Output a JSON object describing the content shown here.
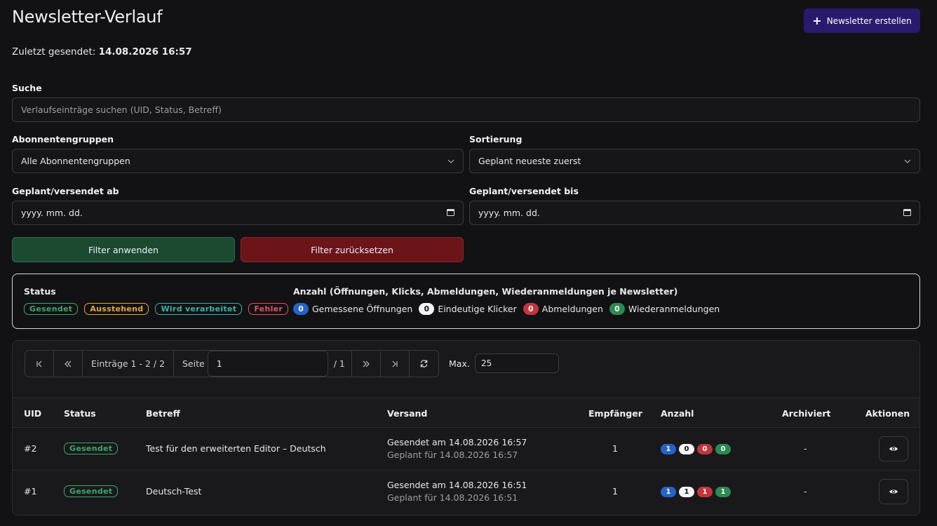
{
  "header": {
    "title": "Newsletter-Verlauf",
    "create_button": "Newsletter erstellen",
    "last_sent_label": "Zuletzt gesendet:",
    "last_sent_value": "14.08.2026 16:57"
  },
  "filters": {
    "search_label": "Suche",
    "search_placeholder": "Verlaufseinträge suchen (UID, Status, Betreff)",
    "groups_label": "Abonnentengruppen",
    "groups_value": "Alle Abonnentengruppen",
    "sort_label": "Sortierung",
    "sort_value": "Geplant neueste zuerst",
    "from_label": "Geplant/versendet ab",
    "from_value": "yyyy. mm. dd.",
    "to_label": "Geplant/versendet bis",
    "to_value": "yyyy. mm. dd.",
    "apply_button": "Filter anwenden",
    "reset_button": "Filter zurücksetzen"
  },
  "legend": {
    "status_title": "Status",
    "statuses": [
      "Gesendet",
      "Ausstehend",
      "Wird verarbeitet",
      "Fehler"
    ],
    "counts_title": "Anzahl (Öffnungen, Klicks, Abmeldungen, Wiederanmeldungen je Newsletter)",
    "counts": [
      {
        "value": "0",
        "label": "Gemessene Öffnungen"
      },
      {
        "value": "0",
        "label": "Eindeutige Klicker"
      },
      {
        "value": "0",
        "label": "Abmeldungen"
      },
      {
        "value": "0",
        "label": "Wiederanmeldungen"
      }
    ]
  },
  "pager": {
    "entries": "Einträge 1 - 2 / 2",
    "page_label": "Seite",
    "page_value": "1",
    "page_total": "/ 1",
    "max_label": "Max.",
    "max_value": "25"
  },
  "table": {
    "headers": [
      "UID",
      "Status",
      "Betreff",
      "Versand",
      "Empfänger",
      "Anzahl",
      "Archiviert",
      "Aktionen"
    ],
    "rows": [
      {
        "uid": "#2",
        "status": "Gesendet",
        "subject": "Test für den erweiterten Editor – Deutsch",
        "sent": "Gesendet am  14.08.2026 16:57",
        "planned": "Geplant für  14.08.2026 16:57",
        "recipients": "1",
        "counts": [
          "1",
          "0",
          "0",
          "0"
        ],
        "archived": "-"
      },
      {
        "uid": "#1",
        "status": "Gesendet",
        "subject": "Deutsch-Test",
        "sent": "Gesendet am  14.08.2026 16:51",
        "planned": "Geplant für  14.08.2026 16:51",
        "recipients": "1",
        "counts": [
          "1",
          "1",
          "1",
          "1"
        ],
        "archived": "-"
      }
    ]
  }
}
